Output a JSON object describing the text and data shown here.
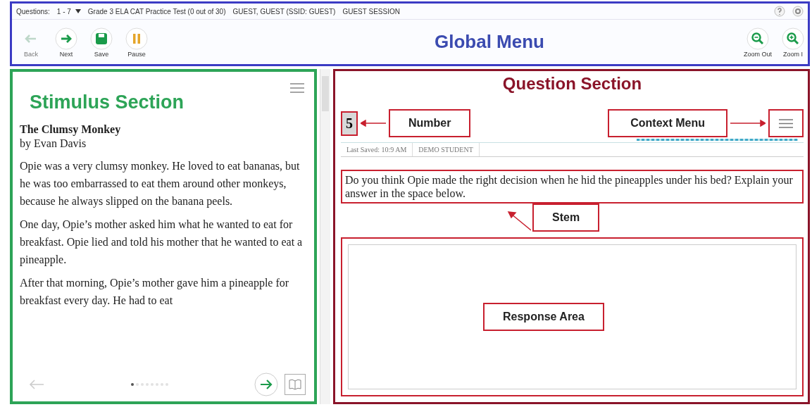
{
  "global_menu": {
    "questions_label": "Questions:",
    "questions_range": "1 - 7",
    "test_title": "Grade 3 ELA CAT Practice Test (0 out of 30)",
    "student": "GUEST, GUEST (SSID: GUEST)",
    "session": "GUEST SESSION",
    "title": "Global Menu",
    "left_buttons": [
      {
        "label": "Back",
        "kind": "back",
        "disabled": true
      },
      {
        "label": "Next",
        "kind": "next",
        "disabled": false
      },
      {
        "label": "Save",
        "kind": "save",
        "disabled": false
      },
      {
        "label": "Pause",
        "kind": "pause",
        "disabled": false
      }
    ],
    "right_buttons": [
      {
        "label": "Zoom Out",
        "kind": "zoom_out"
      },
      {
        "label": "Zoom I",
        "kind": "zoom_in"
      }
    ]
  },
  "stimulus": {
    "title": "Stimulus Section",
    "passage_title": "The Clumsy Monkey",
    "author": "by Evan Davis",
    "paragraphs": [
      "Opie was a very clumsy monkey. He loved to eat bananas, but he was too embarrassed to eat them around other monkeys, because he always slipped on the banana peels.",
      "One day, Opie’s mother asked him what he wanted to eat for breakfast. Opie lied and told his mother that he wanted to eat a pineapple.",
      "After that morning, Opie’s mother gave him a pineapple for breakfast every day. He had to eat"
    ],
    "pages": [
      {
        "selected": true
      },
      {
        "selected": false
      },
      {
        "selected": false
      },
      {
        "selected": false
      },
      {
        "selected": false
      },
      {
        "selected": false
      },
      {
        "selected": false
      },
      {
        "selected": false
      }
    ]
  },
  "question": {
    "title": "Question Section",
    "number": "5",
    "number_callout": "Number",
    "menu_callout": "Context Menu",
    "last_saved": "Last Saved: 10:9 AM",
    "student": "DEMO STUDENT",
    "stem": "Do you think Opie made the right decision when he hid the pineapples under his bed? Explain your answer in the space below.",
    "stem_callout": "Stem",
    "response_callout": "Response Area"
  }
}
